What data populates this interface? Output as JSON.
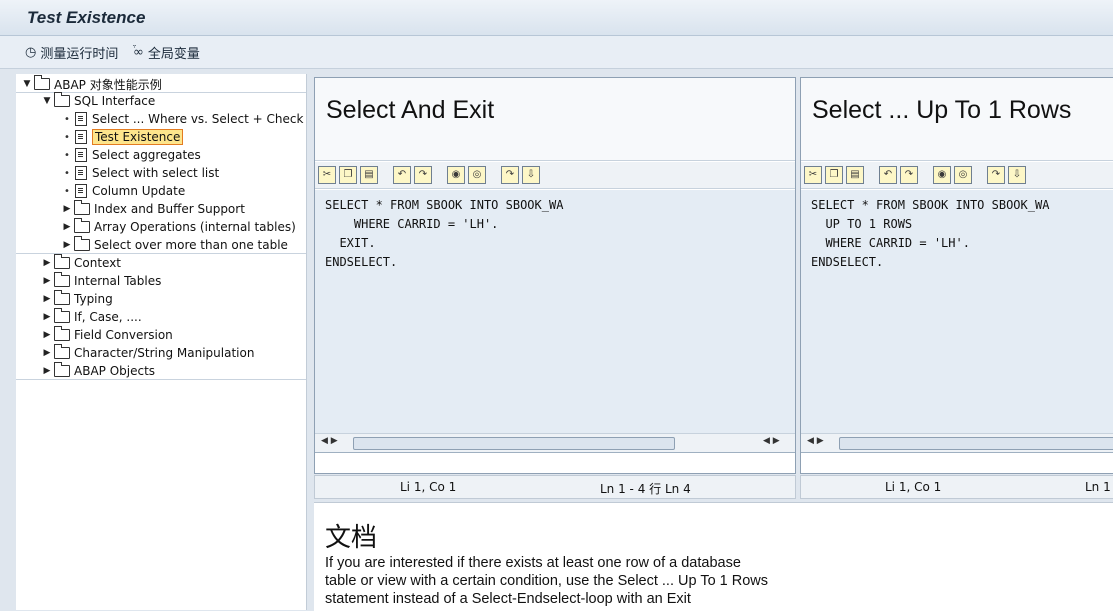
{
  "window": {
    "title": "Test Existence"
  },
  "toolbar": {
    "measure_label": "测量运行时间",
    "globals_label": "全局变量"
  },
  "tree": {
    "root": "ABAP 对象性能示例",
    "sql_interface": "SQL Interface",
    "sql_items": [
      "Select ... Where vs. Select + Check",
      "Test Existence",
      "Select aggregates",
      "Select with select list",
      "Column Update"
    ],
    "sql_folders": [
      "Index and Buffer Support",
      "Array Operations (internal tables)",
      "Select over more than one table"
    ],
    "folders": [
      "Context",
      "Internal Tables",
      "Typing",
      "If, Case, ....",
      "Field Conversion",
      "Character/String Manipulation",
      "ABAP Objects"
    ]
  },
  "left_pane": {
    "title": "Select And Exit",
    "code": "SELECT * FROM SBOOK INTO SBOOK_WA\n    WHERE CARRID = 'LH'.\n  EXIT.\nENDSELECT.",
    "status_pos": "Li 1, Co 1",
    "status_lines": "Ln 1 - 4 行 Ln 4"
  },
  "right_pane": {
    "title": "Select ... Up To 1 Rows",
    "code": "SELECT * FROM SBOOK INTO SBOOK_WA\n  UP TO 1 ROWS\n  WHERE CARRID = 'LH'.\nENDSELECT.",
    "status_pos": "Li 1, Co 1",
    "status_lines": "Ln 1"
  },
  "documentation": {
    "title": "文档",
    "text": "If you are interested if there exists at least one row of a database table or view with a certain condition, use the Select ... Up To 1 Rows statement instead of a Select-Endselect-loop with an Exit"
  }
}
